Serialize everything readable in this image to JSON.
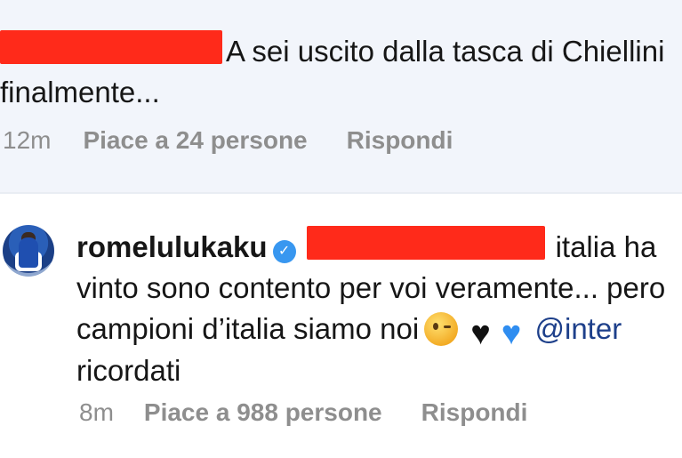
{
  "comments": [
    {
      "text": "A sei uscito dalla tasca di Chiellini finalmente...",
      "time": "12m",
      "likes": "Piace a 24 persone",
      "reply": "Rispondi"
    },
    {
      "username": "romelulukaku",
      "verified": true,
      "text_after_redaction": "italia ha vinto sono contento per voi veramente... pero campioni d’italia siamo noi",
      "mention": "@inter",
      "text_end": "ricordati",
      "emojis": [
        "winking-face",
        "black-heart",
        "blue-heart"
      ],
      "time": "8m",
      "likes": "Piace a 988 persone",
      "reply": "Rispondi"
    }
  ],
  "colors": {
    "redaction": "#ff2a1a",
    "highlight_background": "#f2f5fb",
    "meta_text": "#8e8e8e",
    "mention": "#1d3f8a",
    "verified_badge": "#3897f0"
  }
}
